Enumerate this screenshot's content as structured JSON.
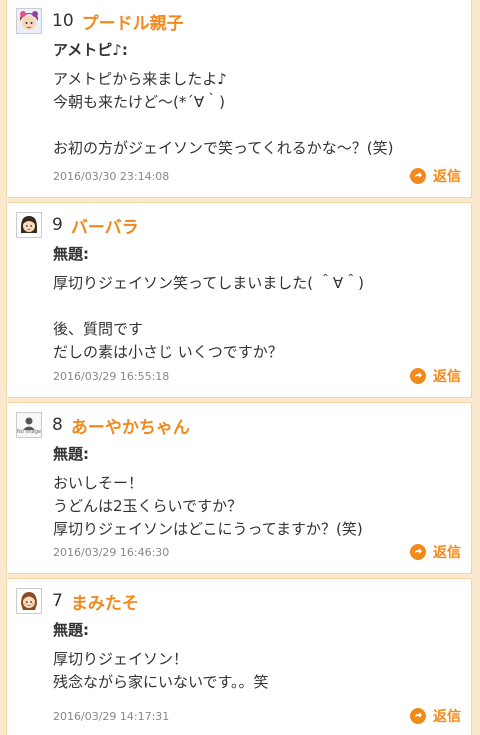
{
  "accent_color": "#f08a1c",
  "reply_label": "返信",
  "comments": [
    {
      "number": "10",
      "author": "プードル親子",
      "avatar_icon": "girl-face-icon",
      "subject": "アメトピ♪:",
      "text": "アメトピから来ましたよ♪\n今朝も来たけど〜(*´∀｀)\n\nお初の方がジェイソンで笑ってくれるかな〜？(笑)",
      "date": "2016/03/30 23:14:08"
    },
    {
      "number": "9",
      "author": "バーバラ",
      "avatar_icon": "woman-face-icon",
      "subject": "無題:",
      "text": "厚切りジェイソン笑ってしまいました( ＾∀＾)\n\n後、質問です\nだしの素は小さじ いくつですか？",
      "date": "2016/03/29 16:55:18"
    },
    {
      "number": "8",
      "author": "あーやかちゃん",
      "avatar_icon": "no-image-icon",
      "avatar_label": "No image",
      "subject": "無題:",
      "text": "おいしそー！\nうどんは2玉くらいですか？\n厚切りジェイソンはどこにうってますか？(笑)",
      "date": "2016/03/29 16:46:30"
    },
    {
      "number": "7",
      "author": "まみたそ",
      "avatar_icon": "girl-face-icon",
      "subject": "無題:",
      "text": "厚切りジェイソン！\n残念ながら家にいないです。。笑",
      "date": "2016/03/29 14:17:31"
    }
  ]
}
